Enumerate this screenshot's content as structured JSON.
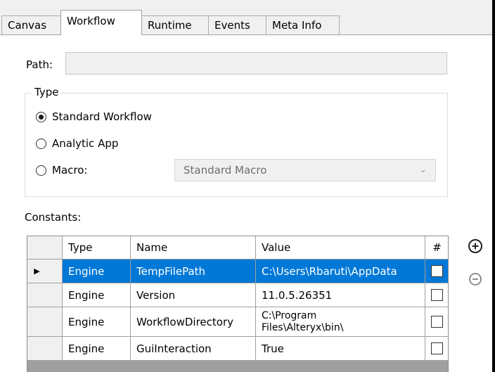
{
  "tabs": [
    {
      "label": "Canvas",
      "active": false
    },
    {
      "label": "Workflow",
      "active": true
    },
    {
      "label": "Runtime",
      "active": false
    },
    {
      "label": "Events",
      "active": false
    },
    {
      "label": "Meta Info",
      "active": false
    }
  ],
  "path": {
    "label": "Path:",
    "value": ""
  },
  "type_group": {
    "title": "Type",
    "options": [
      {
        "label": "Standard Workflow",
        "checked": true
      },
      {
        "label": "Analytic App",
        "checked": false
      },
      {
        "label": "Macro:",
        "checked": false
      }
    ],
    "macro_select": {
      "value": "Standard Macro",
      "enabled": false
    }
  },
  "constants": {
    "label": "Constants:",
    "columns": [
      "Type",
      "Name",
      "Value",
      "#"
    ],
    "rows": [
      {
        "type": "Engine",
        "name": "TempFilePath",
        "value": "C:\\Users\\Rbaruti\\AppData",
        "checked": false,
        "selected": true
      },
      {
        "type": "Engine",
        "name": "Version",
        "value": "11.0.5.26351",
        "checked": false,
        "selected": false
      },
      {
        "type": "Engine",
        "name": "WorkflowDirectory",
        "value": "C:\\Program Files\\Alteryx\\bin\\",
        "checked": false,
        "selected": false
      },
      {
        "type": "Engine",
        "name": "GuiInteraction",
        "value": "True",
        "checked": false,
        "selected": false
      }
    ]
  },
  "buttons": {
    "add_icon": "plus-circle-icon",
    "remove_icon": "minus-circle-icon"
  }
}
